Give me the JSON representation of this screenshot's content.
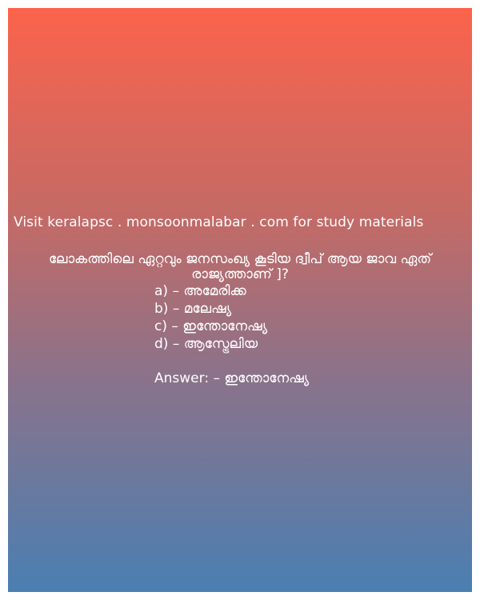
{
  "site_text": "Visit keralapsc . monsoonmalabar . com for study materials",
  "question": {
    "line1": "ലോകത്തിലെ ഏറ്റവും ജനസംഖ്യ കൂടിയ ദ്വീപ് ആയ ജാവ ഏത്",
    "line2": "രാജ്യത്താണ് ]?"
  },
  "options": [
    "a) – അമേരിക്ക",
    "b) – മലേഷ്യ",
    "c) – ഇന്തോനേഷ്യ",
    "d) – ആസ്ട്രേലിയ"
  ],
  "answer": "Answer: – ഇന്തോനേഷ്യ",
  "colors": {
    "gradient_top": "#fb634b",
    "gradient_bottom": "#4a7fb2",
    "text": "#ffffff"
  }
}
